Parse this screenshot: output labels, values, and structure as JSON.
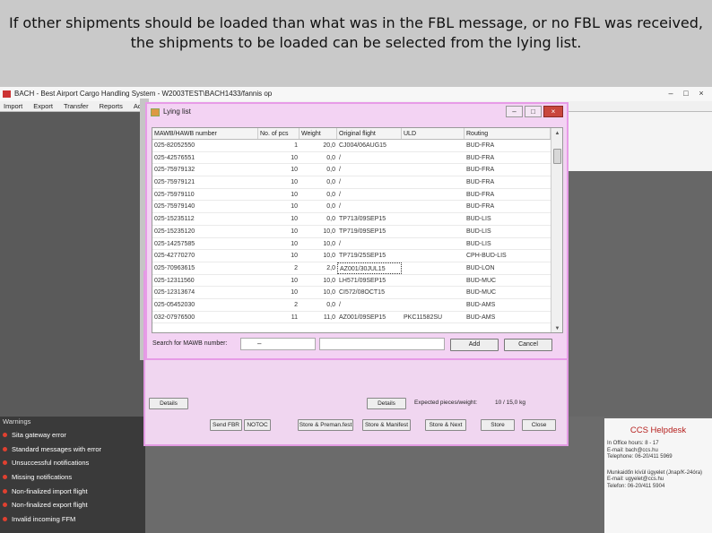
{
  "caption": {
    "line1": "If other shipments should be loaded than what was in the FBL message, or no FBL was received,",
    "line2": "the shipments to be loaded can be selected from the lying list."
  },
  "app": {
    "title": "BACH - Best Airport Cargo Handling System - W2003TEST\\BACH1433/fannis op",
    "menu": [
      "Import",
      "Export",
      "Transfer",
      "Reports",
      "Administr..."
    ],
    "window_buttons": [
      "–",
      "□",
      "×"
    ]
  },
  "dialog": {
    "title": "Lying list",
    "window_buttons": [
      "–",
      "□",
      "×"
    ],
    "columns": [
      "MAWB/HAWB number",
      "No. of pcs",
      "Weight",
      "Original flight",
      "ULD",
      "Routing"
    ],
    "rows": [
      [
        "025-82052550",
        "1",
        "20,0",
        "CJ004/06AUG15",
        "",
        "BUD-FRA"
      ],
      [
        "025-42576551",
        "10",
        "0,0",
        "/",
        "",
        "BUD-FRA"
      ],
      [
        "025-75979132",
        "10",
        "0,0",
        "/",
        "",
        "BUD-FRA"
      ],
      [
        "025-75979121",
        "10",
        "0,0",
        "/",
        "",
        "BUD-FRA"
      ],
      [
        "025-75979110",
        "10",
        "0,0",
        "/",
        "",
        "BUD-FRA"
      ],
      [
        "025-75979140",
        "10",
        "0,0",
        "/",
        "",
        "BUD-FRA"
      ],
      [
        "025-15235112",
        "10",
        "0,0",
        "TP713/09SEP15",
        "",
        "BUD-LIS"
      ],
      [
        "025-15235120",
        "10",
        "10,0",
        "TP719/09SEP15",
        "",
        "BUD-LIS"
      ],
      [
        "025-14257585",
        "10",
        "10,0",
        "/",
        "",
        "BUD-LIS"
      ],
      [
        "025-42770270",
        "10",
        "10,0",
        "TP719/25SEP15",
        "",
        "CPH-BUD-LIS"
      ],
      [
        "025-70963615",
        "2",
        "2,0",
        "AZ001/30JUL15",
        "",
        "BUD-LON"
      ],
      [
        "025-12311560",
        "10",
        "10,0",
        "LH571/09SEP15",
        "",
        "BUD-MUC"
      ],
      [
        "025-12313674",
        "10",
        "10,0",
        "CI572/08OCT15",
        "",
        "BUD-MUC"
      ],
      [
        "025-05452030",
        "2",
        "0,0",
        "/",
        "",
        "BUD-AMS"
      ],
      [
        "032-07976500",
        "11",
        "11,0",
        "AZ001/09SEP15",
        "PKC11582SU",
        "BUD-AMS"
      ]
    ],
    "selected_cell": "AZ001/30JUL15",
    "search_label": "Search for MAWB number:",
    "search_value": "–",
    "add_label": "Add",
    "cancel_label": "Cancel"
  },
  "background_panel": {
    "x_mark": "x",
    "details_left": "Details",
    "details_right": "Details",
    "expected_label": "Expected pieces/weight:",
    "expected_value": "10 / 15,0 kg",
    "buttons": [
      "Send FBR",
      "NOTOC",
      "Store & Preman.fest",
      "Store & Manifest",
      "Store & Next",
      "Store",
      "Close"
    ]
  },
  "warnings": {
    "title": "Warnings",
    "items": [
      "Sita gateway error",
      "Standard messages with error",
      "Unsuccessful notifications",
      "Missing notifications",
      "Non-finalized import flight",
      "Non-finalized export flight",
      "Invalid incoming FFM"
    ]
  },
  "helpdesk": {
    "title": "CCS Helpdesk",
    "lines": [
      "In Office hours: 8 - 17",
      "E-mail: bach@ccs.hu",
      "Telephone: 06-20/411 5969"
    ],
    "lines2": [
      "Munkaidőn kívül ügyelet (Jnap/K-24óra)",
      "E-mail: ugyelet@ccs.hu",
      "Telefon: 06-20/411 5904"
    ]
  }
}
